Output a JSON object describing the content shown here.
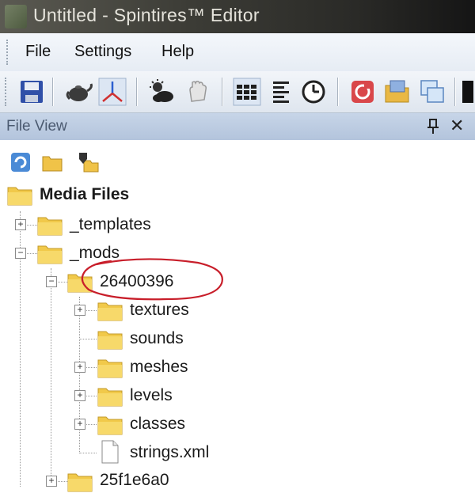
{
  "window": {
    "title": "Untitled - Spintires™ Editor"
  },
  "menu": {
    "items": [
      "File",
      "Settings",
      "Help"
    ]
  },
  "panel": {
    "title": "File View"
  },
  "tree": {
    "root": "Media Files",
    "templates": "_templates",
    "mods": "_mods",
    "mod_id": "26400396",
    "children": [
      "textures",
      "sounds",
      "meshes",
      "levels",
      "classes",
      "strings.xml"
    ],
    "next_mod": "25f1e6a0"
  },
  "annotation_color": "#c81e2a",
  "colors": {
    "folder": "#f1c94a",
    "panel_header": "#b8c8de"
  }
}
